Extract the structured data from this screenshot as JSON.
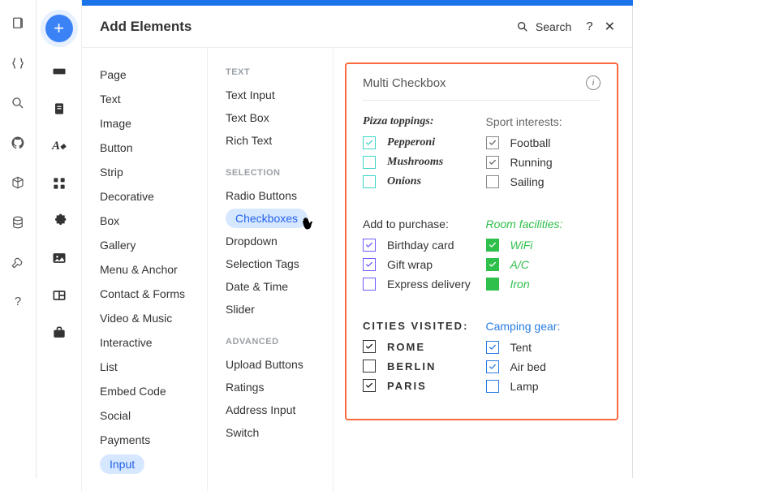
{
  "header": {
    "title": "Add Elements",
    "search_label": "Search",
    "help_label": "?",
    "close_label": "✕"
  },
  "categories": [
    {
      "label": "Page"
    },
    {
      "label": "Text"
    },
    {
      "label": "Image"
    },
    {
      "label": "Button"
    },
    {
      "label": "Strip"
    },
    {
      "label": "Decorative"
    },
    {
      "label": "Box"
    },
    {
      "label": "Gallery"
    },
    {
      "label": "Menu & Anchor"
    },
    {
      "label": "Contact & Forms"
    },
    {
      "label": "Video & Music"
    },
    {
      "label": "Interactive"
    },
    {
      "label": "List"
    },
    {
      "label": "Embed Code"
    },
    {
      "label": "Social"
    },
    {
      "label": "Payments"
    },
    {
      "label": "Input",
      "selected": true
    }
  ],
  "groups": [
    {
      "heading": "TEXT",
      "items": [
        {
          "label": "Text Input"
        },
        {
          "label": "Text Box"
        },
        {
          "label": "Rich Text"
        }
      ]
    },
    {
      "heading": "SELECTION",
      "items": [
        {
          "label": "Radio Buttons"
        },
        {
          "label": "Checkboxes",
          "selected": true
        },
        {
          "label": "Dropdown"
        },
        {
          "label": "Selection Tags"
        },
        {
          "label": "Date & Time"
        },
        {
          "label": "Slider"
        }
      ]
    },
    {
      "heading": "ADVANCED",
      "items": [
        {
          "label": "Upload Buttons"
        },
        {
          "label": "Ratings"
        },
        {
          "label": "Address Input"
        },
        {
          "label": "Switch"
        }
      ]
    }
  ],
  "preview": {
    "title": "Multi Checkbox",
    "info": "i",
    "groups": {
      "pizza": {
        "title": "Pizza toppings:",
        "options": [
          {
            "label": "Pepperoni",
            "checked": true
          },
          {
            "label": "Mushrooms",
            "checked": false
          },
          {
            "label": "Onions",
            "checked": false
          }
        ]
      },
      "sport": {
        "title": "Sport interests:",
        "options": [
          {
            "label": "Football",
            "checked": true
          },
          {
            "label": "Running",
            "checked": true
          },
          {
            "label": "Sailing",
            "checked": false
          }
        ]
      },
      "purchase": {
        "title": "Add to purchase:",
        "options": [
          {
            "label": "Birthday card",
            "checked": true
          },
          {
            "label": "Gift wrap",
            "checked": true
          },
          {
            "label": "Express delivery",
            "checked": false
          }
        ]
      },
      "room": {
        "title": "Room facilities:",
        "options": [
          {
            "label": "WiFi",
            "checked": true
          },
          {
            "label": "A/C",
            "checked": true
          },
          {
            "label": "Iron",
            "checked": false
          }
        ]
      },
      "cities": {
        "title": "Cities visited:",
        "options": [
          {
            "label": "Rome",
            "checked": true
          },
          {
            "label": "Berlin",
            "checked": false
          },
          {
            "label": "Paris",
            "checked": true
          }
        ]
      },
      "camp": {
        "title": "Camping gear:",
        "options": [
          {
            "label": "Tent",
            "checked": true
          },
          {
            "label": "Air bed",
            "checked": true
          },
          {
            "label": "Lamp",
            "checked": false
          }
        ]
      }
    }
  }
}
